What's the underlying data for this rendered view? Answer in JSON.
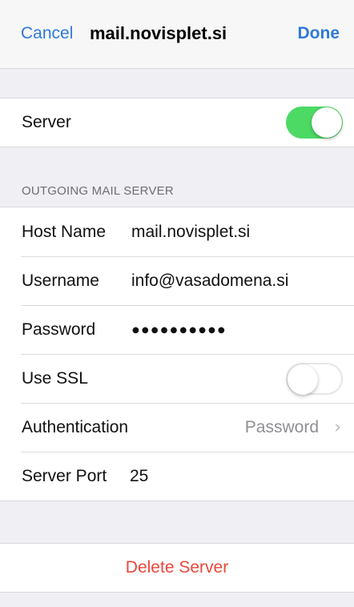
{
  "navbar": {
    "cancel_label": "Cancel",
    "title": "mail.novisplet.si",
    "done_label": "Done"
  },
  "server_toggle": {
    "label": "Server",
    "state": "on"
  },
  "outgoing_section": {
    "header": "OUTGOING MAIL SERVER",
    "host_name_label": "Host Name",
    "host_name_value": "mail.novisplet.si",
    "username_label": "Username",
    "username_value": "info@vasadomena.si",
    "password_label": "Password",
    "password_value": "●●●●●●●●●●",
    "use_ssl_label": "Use SSL",
    "use_ssl_state": "off",
    "authentication_label": "Authentication",
    "authentication_value": "Password",
    "server_port_label": "Server Port",
    "server_port_value": "25"
  },
  "delete": {
    "label": "Delete Server"
  },
  "colors": {
    "accent": "#2f7ad7",
    "switch_on": "#4cd964",
    "destructive": "#e9473b",
    "background": "#efeff4"
  }
}
